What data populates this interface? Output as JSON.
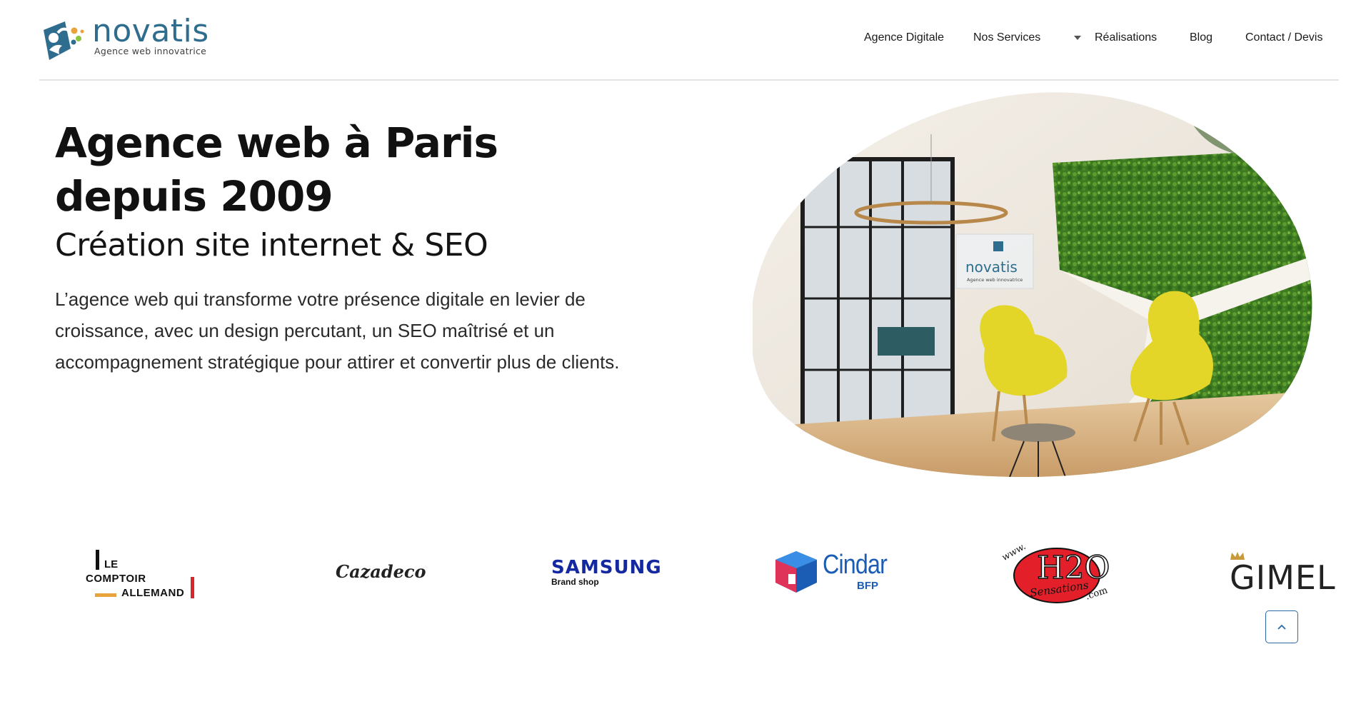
{
  "brand": {
    "name": "novatis",
    "tagline": "Agence web innovatrice",
    "colors": {
      "primary": "#2f6d8e",
      "accent_orange": "#e8a33a",
      "accent_green": "#8cc63f"
    }
  },
  "nav": {
    "items": [
      {
        "label": "Agence Digitale"
      },
      {
        "label": "Nos Services",
        "has_dropdown": true
      },
      {
        "label": "Réalisations"
      },
      {
        "label": "Blog"
      },
      {
        "label": "Contact / Devis"
      }
    ]
  },
  "hero": {
    "title": "Agence web à Paris depuis 2009",
    "subtitle": "Création site internet & SEO",
    "description": "L’agence web qui transforme votre présence digitale en levier de croissance, avec un design percutant, un SEO maîtrisé et un accompagnement stratégique pour attirer et convertir plus de clients.",
    "image_alt": "office lounge with yellow chairs and moss wall",
    "image_sign": {
      "name": "novatis",
      "tagline": "Agence web innovatrice"
    }
  },
  "clients": {
    "logos": [
      {
        "name": "le-comptoir-allemand",
        "lines": [
          "LE",
          "COMPTOIR",
          "ALLEMAND"
        ]
      },
      {
        "name": "cazadeco",
        "text": "Cazadeco"
      },
      {
        "name": "samsung",
        "text": "SAMSUNG",
        "sub": "Brand shop"
      },
      {
        "name": "cindar",
        "text": "Cindar",
        "sub": "BFP"
      },
      {
        "name": "h2o-sensations",
        "text": "H2O",
        "prefix": "www.",
        "sub": "Sensations",
        "suffix": ".com"
      },
      {
        "name": "gimel",
        "text": "GIMEL"
      }
    ]
  },
  "ui": {
    "scroll_top_icon": "chevron-up-icon"
  }
}
